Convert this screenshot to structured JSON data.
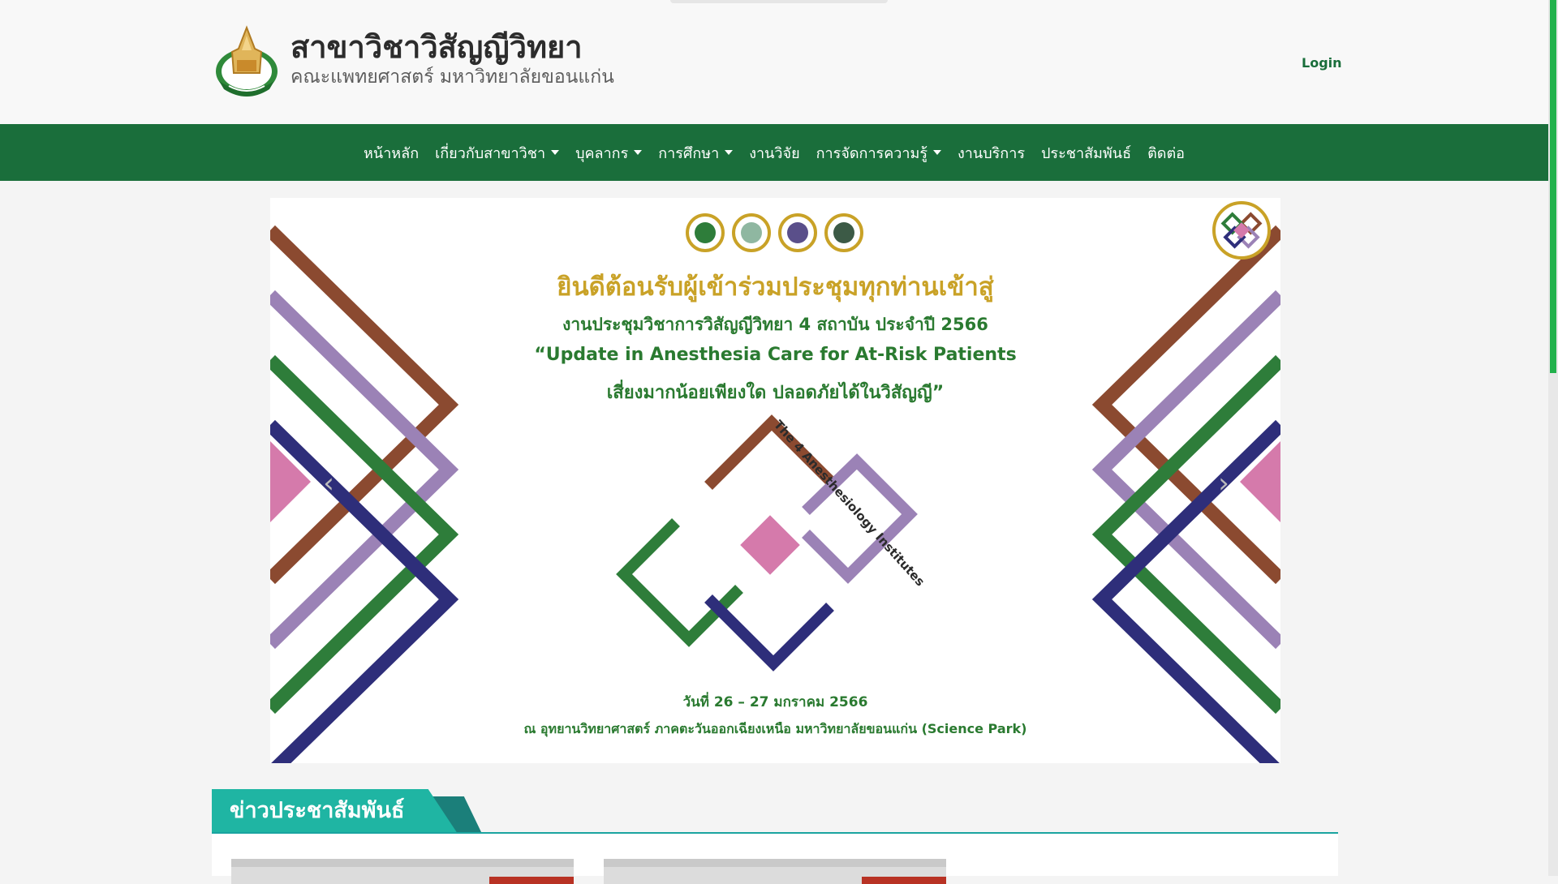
{
  "header": {
    "site_title": "สาขาวิชาวิสัญญีวิทยา",
    "site_subtitle": "คณะแพทยศาสตร์ มหาวิทยาลัยขอนแก่น",
    "login_label": "Login",
    "logo_icon": "faculty-crest-icon"
  },
  "nav": {
    "items": [
      {
        "label": "หน้าหลัก",
        "dropdown": false
      },
      {
        "label": "เกี่ยวกับสาขาวิชา",
        "dropdown": true
      },
      {
        "label": "บุคลากร",
        "dropdown": true
      },
      {
        "label": "การศึกษา",
        "dropdown": true
      },
      {
        "label": "งานวิจัย",
        "dropdown": false
      },
      {
        "label": "การจัดการความรู้",
        "dropdown": true
      },
      {
        "label": "งานบริการ",
        "dropdown": false
      },
      {
        "label": "ประชาสัมพันธ์",
        "dropdown": false
      },
      {
        "label": "ติดต่อ",
        "dropdown": false
      }
    ]
  },
  "banner": {
    "welcome": "ยินดีต้อนรับผู้เข้าร่วมประชุมทุกท่านเข้าสู่",
    "conference": "งานประชุมวิชาการวิสัญญีวิทยา 4 สถาบัน ประจำปี 2566",
    "quote_line1": "“Update in Anesthesia Care for At-Risk Patients",
    "quote_line2": "เสี่ยงมากน้อยเพียงใด ปลอดภัยได้ในวิสัญญี”",
    "logo_caption": "The 4 Anesthesiology Institutes",
    "date": "วันที่ 26 – 27 มกราคม 2566",
    "venue": "ณ อุทยานวิทยาศาสตร์ ภาคตะวันออกเฉียงเหนือ มหาวิทยาลัยขอนแก่น (Science Park)",
    "prev_icon": "chevron-left-icon",
    "next_icon": "chevron-right-icon"
  },
  "news": {
    "section_title": "ข่าวประชาสัมพันธ์"
  },
  "colors": {
    "nav_green": "#1a6e3b",
    "news_teal": "#1fb5a3",
    "gold": "#c9a227",
    "brown": "#8b4a30",
    "purple": "#9b82b6",
    "green": "#2e7d3a",
    "navy": "#2e2e7a",
    "pink": "#d57aab"
  }
}
